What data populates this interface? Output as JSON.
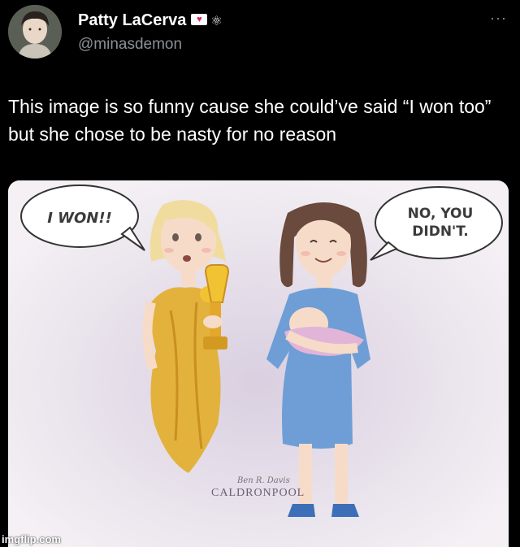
{
  "author": {
    "display_name": "Patty LaCerva",
    "handle": "@minasdemon",
    "badge_icon": "heart-envelope-icon",
    "extra_icon": "tulip-icon"
  },
  "more_menu": {
    "label": "···"
  },
  "tweet": {
    "text": "This image is so funny cause she could’ve said “I won too” but she chose to be nasty for no reason"
  },
  "cartoon": {
    "bubble_left": "I WON!!",
    "bubble_right_line1": "NO, YOU",
    "bubble_right_line2": "DIDN'T.",
    "signature": "Ben R. Davis",
    "publisher": "CALDRONPOOL"
  },
  "watermark": "imgflip.com",
  "colors": {
    "background": "#000000",
    "text": "#ffffff",
    "muted": "#8b9095",
    "gold_dress": "#e3b23c",
    "blue_dress": "#6f9ed6"
  }
}
